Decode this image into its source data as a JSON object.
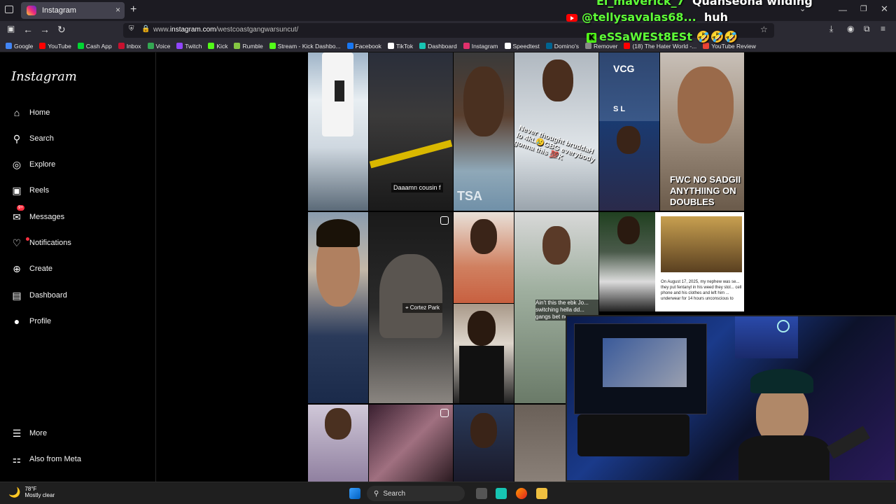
{
  "browser": {
    "tab_title": "Instagram",
    "new_tab": "+",
    "close_tab": "×",
    "url_prefix": "www.",
    "url_domain": "instagram.com",
    "url_path": "/westcoastgangwarsuncut/",
    "back": "←",
    "forward": "→",
    "reload": "↻"
  },
  "bookmarks": [
    {
      "label": "Google",
      "color": "#4285f4"
    },
    {
      "label": "YouTube",
      "color": "#ff0000"
    },
    {
      "label": "Cash App",
      "color": "#00d632"
    },
    {
      "label": "Inbox",
      "color": "#c8102e"
    },
    {
      "label": "Voice",
      "color": "#34a853"
    },
    {
      "label": "Twitch",
      "color": "#9146ff"
    },
    {
      "label": "Kick",
      "color": "#53fc18"
    },
    {
      "label": "Rumble",
      "color": "#85c742"
    },
    {
      "label": "Stream - Kick Dashbo...",
      "color": "#53fc18"
    },
    {
      "label": "Facebook",
      "color": "#1877f2"
    },
    {
      "label": "TikTok",
      "color": "#ffffff"
    },
    {
      "label": "Dashboard",
      "color": "#17c5b3"
    },
    {
      "label": "Instagram",
      "color": "#e1306c"
    },
    {
      "label": "Speedtest",
      "color": "#ffffff"
    },
    {
      "label": "Domino's",
      "color": "#006491"
    },
    {
      "label": "Remover",
      "color": "#888888"
    },
    {
      "label": "(18) The Hater World -...",
      "color": "#ff0000"
    },
    {
      "label": "YouTube Review",
      "color": "#ea4335"
    }
  ],
  "chat": [
    {
      "user": "El_maverick_7",
      "msg": "Quahseona wilding"
    },
    {
      "user": "@tellysavalas68...",
      "msg": "huh"
    },
    {
      "user": "eSSaWESt8ESt",
      "msg": "🤣🤣🤣"
    }
  ],
  "instagram": {
    "logo": "Instagram",
    "nav": [
      {
        "label": "Home",
        "icon": "home-icon",
        "glyph": "⌂"
      },
      {
        "label": "Search",
        "icon": "search-icon",
        "glyph": "⚲"
      },
      {
        "label": "Explore",
        "icon": "explore-icon",
        "glyph": "◎"
      },
      {
        "label": "Reels",
        "icon": "reels-icon",
        "glyph": "▣"
      },
      {
        "label": "Messages",
        "icon": "messages-icon",
        "glyph": "✉",
        "badge": "9+"
      },
      {
        "label": "Notifications",
        "icon": "heart-icon",
        "glyph": "♡"
      },
      {
        "label": "Create",
        "icon": "create-icon",
        "glyph": "⊕"
      },
      {
        "label": "Dashboard",
        "icon": "dashboard-icon",
        "glyph": "▤"
      },
      {
        "label": "Profile",
        "icon": "avatar",
        "glyph": "●"
      }
    ],
    "more": "More",
    "meta": "Also from Meta"
  },
  "grid_captions": {
    "cousin": "Daaamn cousin f",
    "never": "Never thought bruddaH lo 4kL😢GBG everybody gonna this 💯K",
    "fwc": "FWC NO SADGII ANYTHIING ON DOUBLES",
    "cortez": "Cortez Park",
    "aint": "Ain't this the ebk Jo... switching hella dd... gangs bet no",
    "article": "On August 17, 2025, my nephew was se... they put fentanyl in his weed they stol... cell phone and his clothes and left him ... underwear for 14 hours unconscious to",
    "shirt_vcg": "VCG",
    "shirt_sl": "S L",
    "shirt_tsa": "TSA"
  },
  "taskbar": {
    "temp": "78°F",
    "weather": "Mostly clear",
    "search": "Search"
  },
  "colors": {
    "chat_user": "#5fff38",
    "bg": "#000000",
    "notif_badge": "#ff3040"
  }
}
